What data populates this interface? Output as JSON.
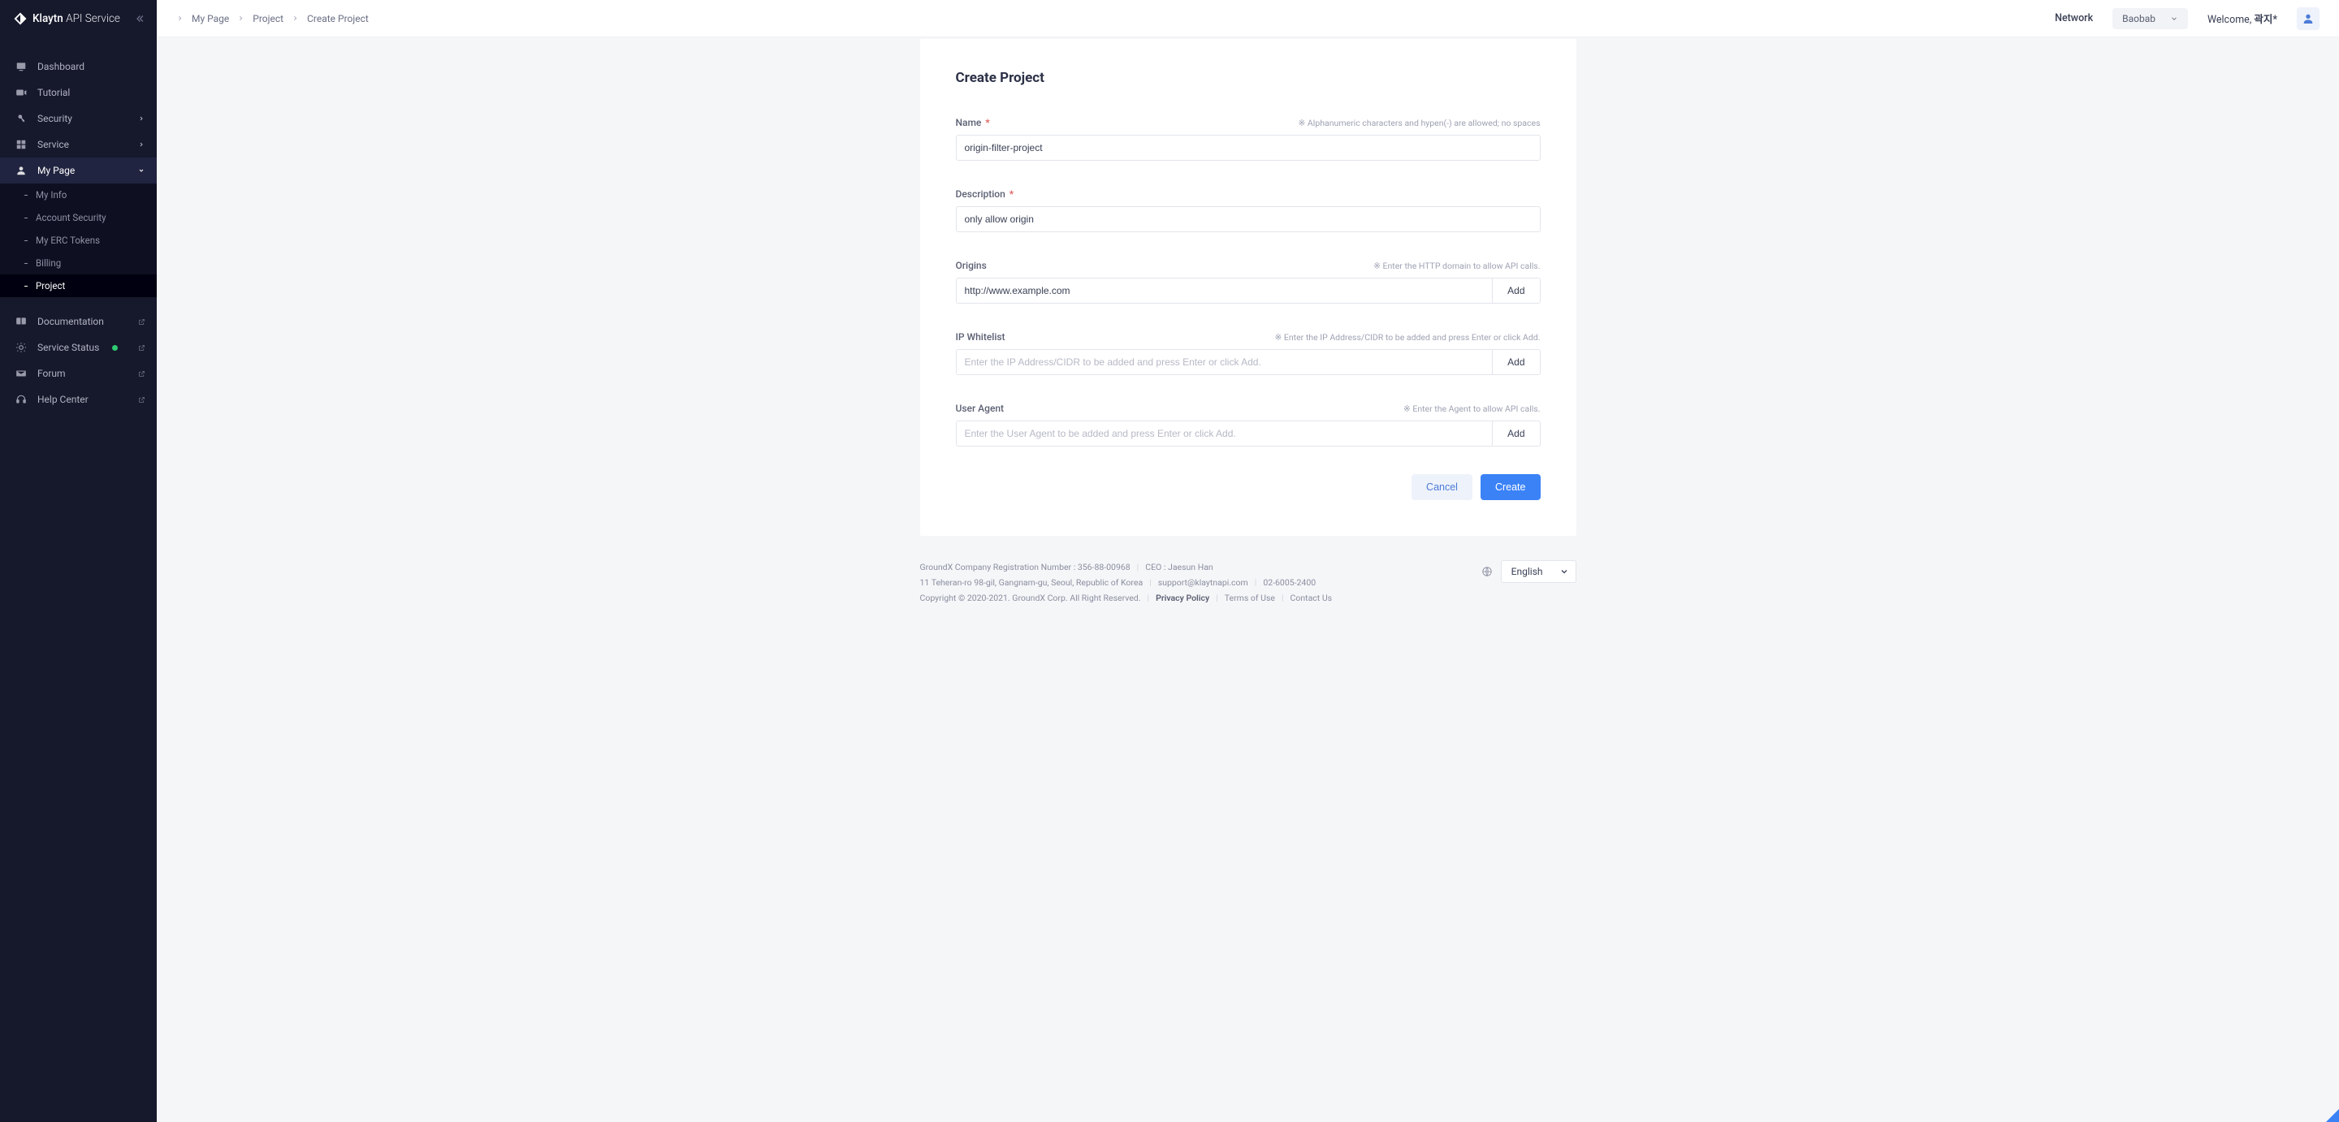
{
  "brand": {
    "bold": "Klaytn",
    "thin": "API Service"
  },
  "breadcrumbs": [
    "My Page",
    "Project",
    "Create Project"
  ],
  "network": {
    "label": "Network",
    "value": "Baobab"
  },
  "welcome": {
    "prefix": "Welcome, ",
    "name": "곽지*"
  },
  "sidebar": {
    "items": [
      {
        "label": "Dashboard"
      },
      {
        "label": "Tutorial"
      },
      {
        "label": "Security"
      },
      {
        "label": "Service"
      },
      {
        "label": "My Page"
      }
    ],
    "mypage_children": [
      {
        "label": "My Info"
      },
      {
        "label": "Account Security"
      },
      {
        "label": "My ERC Tokens"
      },
      {
        "label": "Billing"
      },
      {
        "label": "Project"
      }
    ],
    "bottom": [
      {
        "label": "Documentation"
      },
      {
        "label": "Service Status"
      },
      {
        "label": "Forum"
      },
      {
        "label": "Help Center"
      }
    ]
  },
  "form": {
    "title": "Create Project",
    "name": {
      "label": "Name",
      "hint": "※ Alphanumeric characters and hypen(-) are allowed; no spaces",
      "value": "origin-filter-project"
    },
    "description": {
      "label": "Description",
      "value": "only allow origin"
    },
    "origins": {
      "label": "Origins",
      "hint": "※ Enter the HTTP domain to allow API calls.",
      "value": "http://www.example.com",
      "add": "Add"
    },
    "ip": {
      "label": "IP Whitelist",
      "hint": "※ Enter the IP Address/CIDR to be added and press Enter or click Add.",
      "placeholder": "Enter the IP Address/CIDR to be added and press Enter or click Add.",
      "add": "Add"
    },
    "ua": {
      "label": "User Agent",
      "hint": "※ Enter the Agent to allow API calls.",
      "placeholder": "Enter the User Agent to be added and press Enter or click Add.",
      "add": "Add"
    },
    "cancel": "Cancel",
    "create": "Create"
  },
  "footer": {
    "reg": "GroundX Company Registration Number : 356-88-00968",
    "ceo": "CEO : Jaesun Han",
    "addr": "11 Teheran-ro 98-gil, Gangnam-gu, Seoul, Republic of Korea",
    "email": "support@klaytnapi.com",
    "phone": "02-6005-2400",
    "copyright": "Copyright © 2020-2021. GroundX Corp. All Right Reserved.",
    "privacy": "Privacy Policy",
    "terms": "Terms of Use",
    "contact": "Contact Us",
    "lang": "English"
  }
}
